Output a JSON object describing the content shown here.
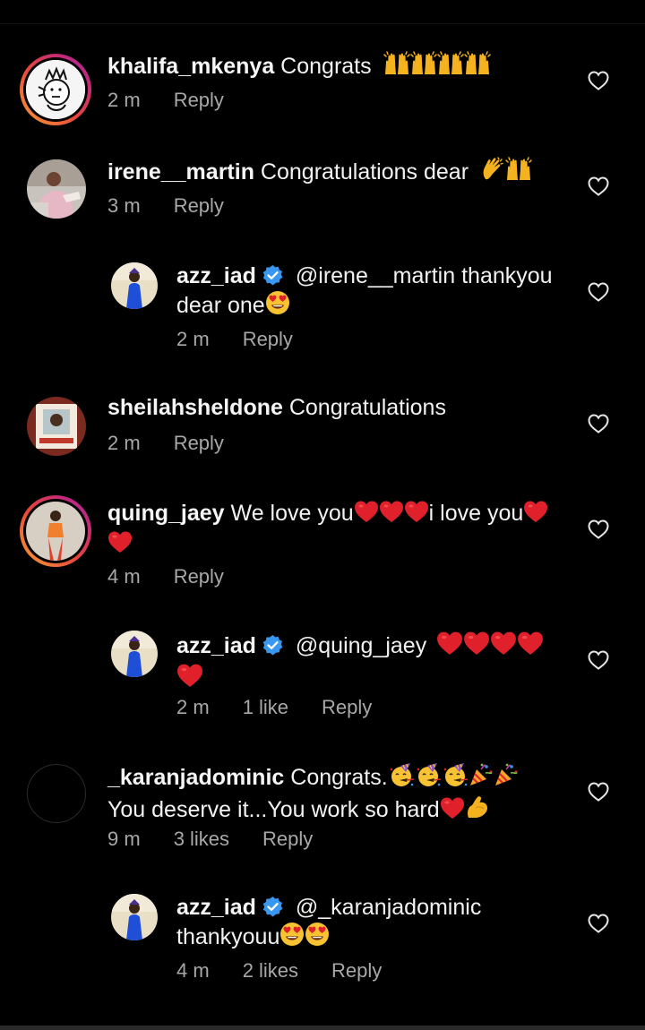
{
  "comments": [
    {
      "username": "khalifa_mkenya",
      "text": "Congrats",
      "time": "2 m",
      "reply": "Reply",
      "emoji": "raised-hands x4"
    },
    {
      "username": "irene__martin",
      "text": "Congratulations dear",
      "time": "3 m",
      "reply": "Reply",
      "emoji": "clap, raised-hands"
    },
    {
      "username": "azz_iad",
      "mention": "@irene__martin",
      "text_line1": "thankyou",
      "text_line2": "dear one",
      "time": "2 m",
      "reply": "Reply",
      "verified": true
    },
    {
      "username": "sheilahsheldone",
      "text": "Congratulations",
      "time": "2 m",
      "reply": "Reply"
    },
    {
      "username": "quing_jaey",
      "text_a": "We love you",
      "text_b": "i love you",
      "time": "4 m",
      "reply": "Reply"
    },
    {
      "username": "azz_iad",
      "mention": "@quing_jaey",
      "time": "2 m",
      "likes": "1 like",
      "reply": "Reply",
      "verified": true
    },
    {
      "username": "_karanjadominic",
      "text_line1": "Congrats.",
      "text_line2": "You deserve it...You work so hard",
      "time": "9 m",
      "likes": "3 likes",
      "reply": "Reply"
    },
    {
      "username": "azz_iad",
      "mention": "@_karanjadominic",
      "text_line2": "thankyouu",
      "time": "4 m",
      "likes": "2 likes",
      "reply": "Reply",
      "verified": true
    }
  ],
  "colors": {
    "background": "#000000",
    "text": "#f2f2f2",
    "meta": "#a8a8a8",
    "verified": "#3897f0",
    "heart_red": "#e0212b"
  },
  "icons": [
    "heart-outline-icon",
    "verified-badge-icon",
    "raised-hands-emoji",
    "clap-emoji",
    "heart-eyes-emoji",
    "red-heart-emoji",
    "party-popper-emoji",
    "flexed-biceps-emoji",
    "party-face-emoji"
  ]
}
